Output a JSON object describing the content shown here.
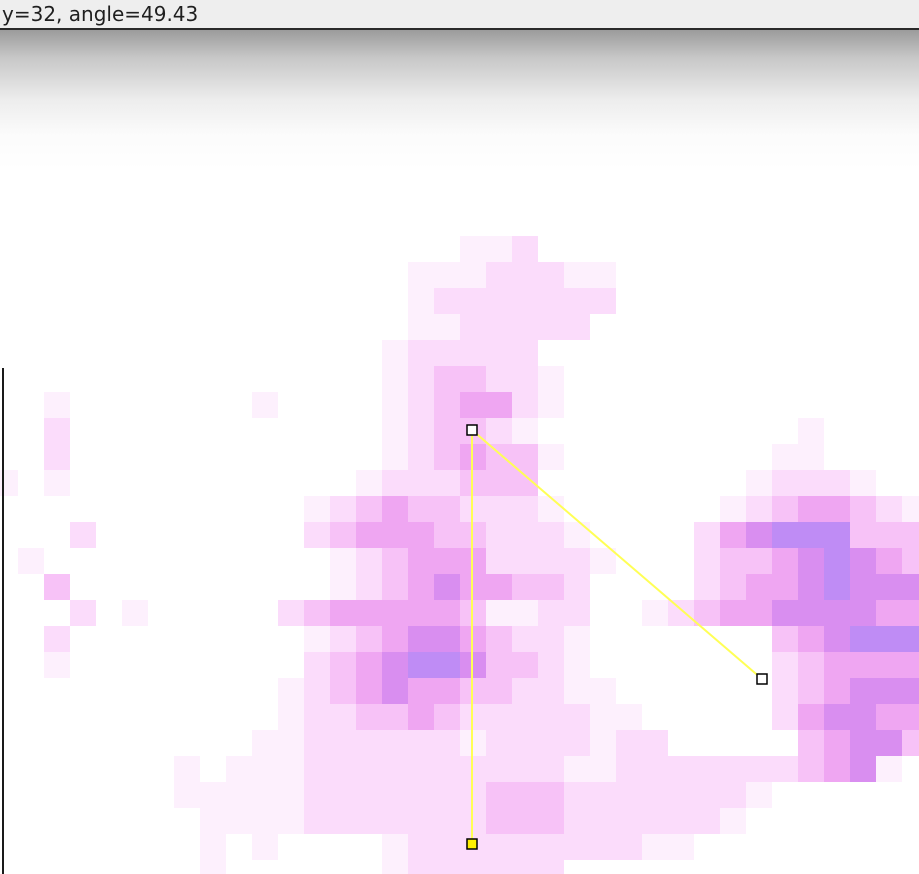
{
  "status": {
    "text": "y=32, angle=49.43"
  },
  "image": {
    "description_icon": "fluorescence-pixel-image",
    "pixel_colors": {
      "1": "#fdf0fd",
      "2": "#fbdcfb",
      "3": "#f7c2f7",
      "4": "#efa6f2",
      "5": "#d98ef0",
      "6": "#bf8cf5"
    }
  },
  "angle_tool": {
    "line_color": "#ffff55",
    "handle_fill": "#ffffff",
    "selected_handle_fill": "#ffef00",
    "handle_stroke": "#000000",
    "handles": [
      {
        "name": "vertex-handle"
      },
      {
        "name": "arm-end-handle"
      },
      {
        "name": "anchor-handle-selected"
      }
    ]
  }
}
